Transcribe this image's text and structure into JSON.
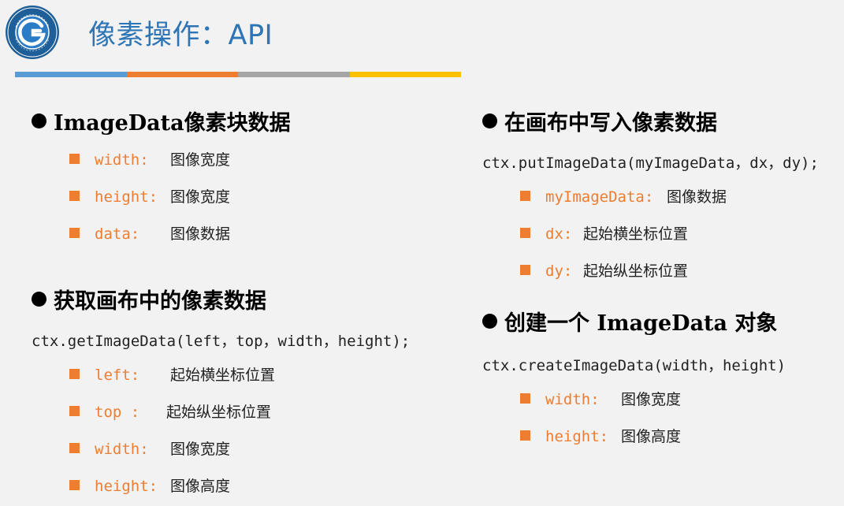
{
  "title": "像素操作：API",
  "colors": {
    "title": "#2e75b6",
    "bullet": "#ed7d31",
    "bar": [
      "#5b9bd5",
      "#ed7d31",
      "#a5a5a5",
      "#ffc000"
    ]
  },
  "left": {
    "sections": [
      {
        "heading": "ImageData像素块数据",
        "items": [
          {
            "key": "width:",
            "value": "图像宽度"
          },
          {
            "key": "height:",
            "value": "图像宽度"
          },
          {
            "key": "data:",
            "value": "图像数据"
          }
        ]
      },
      {
        "heading": "获取画布中的像素数据",
        "code": "ctx.getImageData(left，top，width，height);",
        "items": [
          {
            "key": "left:",
            "value": "起始横坐标位置"
          },
          {
            "key": "top :",
            "value": "起始纵坐标位置"
          },
          {
            "key": "width:",
            "value": "图像宽度"
          },
          {
            "key": "height:",
            "value": "图像高度"
          }
        ]
      }
    ]
  },
  "right": {
    "sections": [
      {
        "heading": "在画布中写入像素数据",
        "code": "ctx.putImageData(myImageData，dx，dy);",
        "items": [
          {
            "key": "myImageData:",
            "value": "图像数据"
          },
          {
            "key": "dx:",
            "value": "起始横坐标位置"
          },
          {
            "key": "dy:",
            "value": "起始纵坐标位置"
          }
        ]
      },
      {
        "heading": "创建一个 ImageData 对象",
        "code": "ctx.createImageData(width，height)",
        "items": [
          {
            "key": "width:",
            "value": "图像宽度"
          },
          {
            "key": "height:",
            "value": "图像高度"
          }
        ]
      }
    ]
  }
}
